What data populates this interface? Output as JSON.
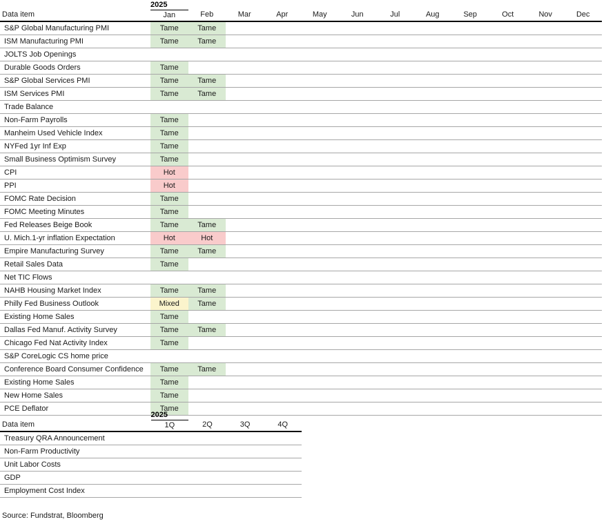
{
  "source_note": "Source: Fundstrat, Bloomberg",
  "monthly_table": {
    "year_label": "2025",
    "row_header_label": "Data item",
    "columns": [
      "Jan",
      "Feb",
      "Mar",
      "Apr",
      "May",
      "Jun",
      "Jul",
      "Aug",
      "Sep",
      "Oct",
      "Nov",
      "Dec"
    ],
    "rows": [
      {
        "label": "S&P Global Manufacturing PMI",
        "values": [
          "Tame",
          "Tame",
          "",
          "",
          "",
          "",
          "",
          "",
          "",
          "",
          "",
          ""
        ]
      },
      {
        "label": "ISM Manufacturing PMI",
        "values": [
          "Tame",
          "Tame",
          "",
          "",
          "",
          "",
          "",
          "",
          "",
          "",
          "",
          ""
        ]
      },
      {
        "label": "JOLTS Job Openings",
        "values": [
          "",
          "",
          "",
          "",
          "",
          "",
          "",
          "",
          "",
          "",
          "",
          ""
        ]
      },
      {
        "label": "Durable Goods Orders",
        "values": [
          "Tame",
          "",
          "",
          "",
          "",
          "",
          "",
          "",
          "",
          "",
          "",
          ""
        ]
      },
      {
        "label": "S&P Global Services PMI",
        "values": [
          "Tame",
          "Tame",
          "",
          "",
          "",
          "",
          "",
          "",
          "",
          "",
          "",
          ""
        ]
      },
      {
        "label": "ISM Services PMI",
        "values": [
          "Tame",
          "Tame",
          "",
          "",
          "",
          "",
          "",
          "",
          "",
          "",
          "",
          ""
        ]
      },
      {
        "label": "Trade Balance",
        "values": [
          "",
          "",
          "",
          "",
          "",
          "",
          "",
          "",
          "",
          "",
          "",
          ""
        ]
      },
      {
        "label": "Non-Farm Payrolls",
        "values": [
          "Tame",
          "",
          "",
          "",
          "",
          "",
          "",
          "",
          "",
          "",
          "",
          ""
        ]
      },
      {
        "label": "Manheim Used Vehicle Index",
        "values": [
          "Tame",
          "",
          "",
          "",
          "",
          "",
          "",
          "",
          "",
          "",
          "",
          ""
        ]
      },
      {
        "label": "NYFed 1yr Inf Exp",
        "values": [
          "Tame",
          "",
          "",
          "",
          "",
          "",
          "",
          "",
          "",
          "",
          "",
          ""
        ]
      },
      {
        "label": "Small Business Optimism Survey",
        "values": [
          "Tame",
          "",
          "",
          "",
          "",
          "",
          "",
          "",
          "",
          "",
          "",
          ""
        ]
      },
      {
        "label": "CPI",
        "values": [
          "Hot",
          "",
          "",
          "",
          "",
          "",
          "",
          "",
          "",
          "",
          "",
          ""
        ]
      },
      {
        "label": "PPI",
        "values": [
          "Hot",
          "",
          "",
          "",
          "",
          "",
          "",
          "",
          "",
          "",
          "",
          ""
        ]
      },
      {
        "label": "FOMC Rate Decision",
        "values": [
          "Tame",
          "",
          "",
          "",
          "",
          "",
          "",
          "",
          "",
          "",
          "",
          ""
        ]
      },
      {
        "label": "FOMC Meeting Minutes",
        "values": [
          "Tame",
          "",
          "",
          "",
          "",
          "",
          "",
          "",
          "",
          "",
          "",
          ""
        ]
      },
      {
        "label": "Fed Releases Beige Book",
        "values": [
          "Tame",
          "Tame",
          "",
          "",
          "",
          "",
          "",
          "",
          "",
          "",
          "",
          ""
        ]
      },
      {
        "label": "U. Mich.1-yr  inflation Expectation",
        "values": [
          "Hot",
          "Hot",
          "",
          "",
          "",
          "",
          "",
          "",
          "",
          "",
          "",
          ""
        ]
      },
      {
        "label": "Empire Manufacturing Survey",
        "values": [
          "Tame",
          "Tame",
          "",
          "",
          "",
          "",
          "",
          "",
          "",
          "",
          "",
          ""
        ]
      },
      {
        "label": "Retail Sales Data",
        "values": [
          "Tame",
          "",
          "",
          "",
          "",
          "",
          "",
          "",
          "",
          "",
          "",
          ""
        ]
      },
      {
        "label": "Net TIC Flows",
        "values": [
          "",
          "",
          "",
          "",
          "",
          "",
          "",
          "",
          "",
          "",
          "",
          ""
        ]
      },
      {
        "label": "NAHB Housing Market Index",
        "values": [
          "Tame",
          "Tame",
          "",
          "",
          "",
          "",
          "",
          "",
          "",
          "",
          "",
          ""
        ]
      },
      {
        "label": "Philly Fed Business Outlook",
        "values": [
          "Mixed",
          "Tame",
          "",
          "",
          "",
          "",
          "",
          "",
          "",
          "",
          "",
          ""
        ]
      },
      {
        "label": "Existing Home Sales",
        "values": [
          "Tame",
          "",
          "",
          "",
          "",
          "",
          "",
          "",
          "",
          "",
          "",
          ""
        ]
      },
      {
        "label": "Dallas Fed Manuf. Activity Survey",
        "values": [
          "Tame",
          "Tame",
          "",
          "",
          "",
          "",
          "",
          "",
          "",
          "",
          "",
          ""
        ]
      },
      {
        "label": "Chicago Fed Nat Activity Index",
        "values": [
          "Tame",
          "",
          "",
          "",
          "",
          "",
          "",
          "",
          "",
          "",
          "",
          ""
        ]
      },
      {
        "label": "S&P CoreLogic CS home price",
        "values": [
          "",
          "",
          "",
          "",
          "",
          "",
          "",
          "",
          "",
          "",
          "",
          ""
        ]
      },
      {
        "label": "Conference Board Consumer Confidence",
        "values": [
          "Tame",
          "Tame",
          "",
          "",
          "",
          "",
          "",
          "",
          "",
          "",
          "",
          ""
        ]
      },
      {
        "label": "Existing Home Sales",
        "values": [
          "Tame",
          "",
          "",
          "",
          "",
          "",
          "",
          "",
          "",
          "",
          "",
          ""
        ]
      },
      {
        "label": "New Home Sales",
        "values": [
          "Tame",
          "",
          "",
          "",
          "",
          "",
          "",
          "",
          "",
          "",
          "",
          ""
        ]
      },
      {
        "label": "PCE Deflator",
        "values": [
          "Tame",
          "",
          "",
          "",
          "",
          "",
          "",
          "",
          "",
          "",
          "",
          ""
        ]
      }
    ]
  },
  "quarterly_table": {
    "year_label": "2025",
    "row_header_label": "Data item",
    "columns": [
      "1Q",
      "2Q",
      "3Q",
      "4Q"
    ],
    "rows": [
      {
        "label": "Treasury QRA Announcement",
        "values": [
          "",
          "",
          "",
          ""
        ]
      },
      {
        "label": "Non-Farm Productivity",
        "values": [
          "",
          "",
          "",
          ""
        ]
      },
      {
        "label": "Unit Labor Costs",
        "values": [
          "",
          "",
          "",
          ""
        ]
      },
      {
        "label": "GDP",
        "values": [
          "",
          "",
          "",
          ""
        ]
      },
      {
        "label": "Employment Cost Index",
        "values": [
          "",
          "",
          "",
          ""
        ]
      }
    ]
  },
  "legend_colors": {
    "tame": "#d9ead3",
    "hot": "#f9cbcb",
    "mixed": "#fbf4cc"
  }
}
